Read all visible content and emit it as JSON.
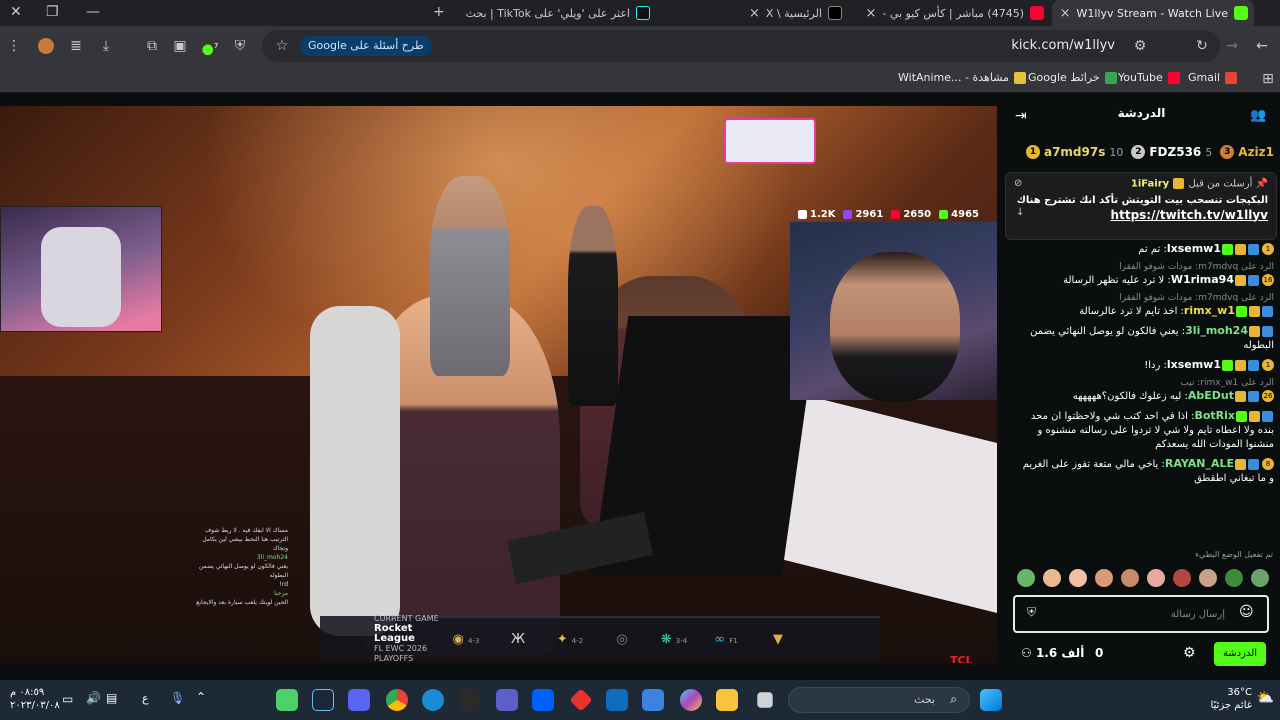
{
  "browser": {
    "tabs": [
      {
        "title": "W1llyv Stream - Watch Live",
        "active": true
      },
      {
        "title": "(4745) مباشر | كأس كيو بي -"
      },
      {
        "title": "الرئيسية \\ X"
      },
      {
        "title": "اعثر على 'ويلي' على TikTok | بحث"
      }
    ],
    "url": "kick.com/w1llyv",
    "google_chip": "طرح أسئلة على Google",
    "extension_badge": "7",
    "bookmarks": [
      "Gmail",
      "YouTube",
      "خرائط Google",
      "مشاهدة - ...WitAnime"
    ]
  },
  "stream": {
    "counters": {
      "tiktok": "1.2K",
      "twitch": "2961",
      "youtube": "2650",
      "kick": "4965"
    },
    "scoreboard": {
      "label_small": "CURRENT GAME",
      "label": "Rocket League",
      "sub": "FL EWC 2026 PLAYOFFS",
      "scores": [
        "4-3",
        "4-2",
        "3-4",
        "F1"
      ]
    },
    "overlay_chat": [
      "مساك الا ايفك فيه . لا ريط شوف الترتيب هنا النحط بيشي لين يكامل وتجاك",
      "3li_moh24",
      "يعني فالكون لو يوصل النهائي يضمن البطوله",
      "rd!",
      "مرحبا",
      "الحين لوينك يلعب سيارة بعد والايجابع"
    ],
    "brand": "TCL"
  },
  "chat": {
    "title": "الدردشة",
    "leaderboard": [
      {
        "rank": "1",
        "name": "a7md97s",
        "points": "10"
      },
      {
        "rank": "2",
        "name": "FDZ536",
        "points": "5"
      },
      {
        "rank": "3",
        "name": "Aziz1",
        "points": ""
      }
    ],
    "pinned": {
      "header": "أرسلت من قبل",
      "user": "1iFairy",
      "body": "البكيجات تنسحب بيت التويتش تأكد انك تشترج هناك",
      "link": "https://twitch.tv/w1llyv"
    },
    "messages": [
      {
        "reply": "",
        "user": "lxsemw1",
        "text": "تم تم",
        "color": "#ffffff",
        "num": "1"
      },
      {
        "reply": "الرد على m7mdvq: مودات شوفو الفقرا",
        "user": "W1rima94",
        "text": "لا ترد عليه تظهر الرسالة",
        "color": "#ffffff",
        "num": "16"
      },
      {
        "reply": "الرد على m7mdvq: مودات شوفو الفقرا",
        "user": "rimx_w1",
        "text": "اخذ تايم لا ترد عالرسالة",
        "color": "#f2d94e",
        "num": ""
      },
      {
        "reply": "",
        "user": "3li_moh24",
        "text": "يعني فالكون لو يوصل النهائي يضمن البطوله",
        "color": "#7fe08a",
        "num": ""
      },
      {
        "reply": "",
        "user": "lxsemw1",
        "text": "ردا!",
        "color": "#ffffff",
        "num": "1"
      },
      {
        "reply": "الرد على rimx_w1: نيب",
        "user": "AbEDut",
        "text": "ليه زعلوك فالكون؟هههههه",
        "color": "#7fe08a",
        "num": "26"
      },
      {
        "reply": "",
        "user": "BotRix",
        "text": "اذا في احد كتب شي ولاحظتوا ان محد بنده ولا اعطاه تايم ولا شي لا تردوا على رسالته منشنوه و منشنوا المودات الله يسعدكم",
        "color": "#7fe08a",
        "num": ""
      },
      {
        "reply": "",
        "user": "RAYAN_ALE",
        "text": "ياخي مالي متعة تفوز على الغريم و ما تبغاني اطقطق",
        "color": "#7fe08a",
        "num": "8"
      }
    ],
    "sub_label": "تم تفعيل الوضع البطيء",
    "input_placeholder": "إرسال رسالة",
    "viewers": "1.6 ألف",
    "zero": "0",
    "chat_button": "الدردشة"
  },
  "taskbar": {
    "clock_time": "٠٨:٥٩ م",
    "clock_date": "٢٠٢٣/٠٣/٠٨",
    "lang": "ع",
    "search_label": "بحث",
    "temperature": "36°C",
    "weather": "غائم جزئيًا"
  },
  "colors": {
    "kick_green": "#53fc18",
    "chrome_dark": "#202124",
    "toolbar": "#35363a"
  }
}
